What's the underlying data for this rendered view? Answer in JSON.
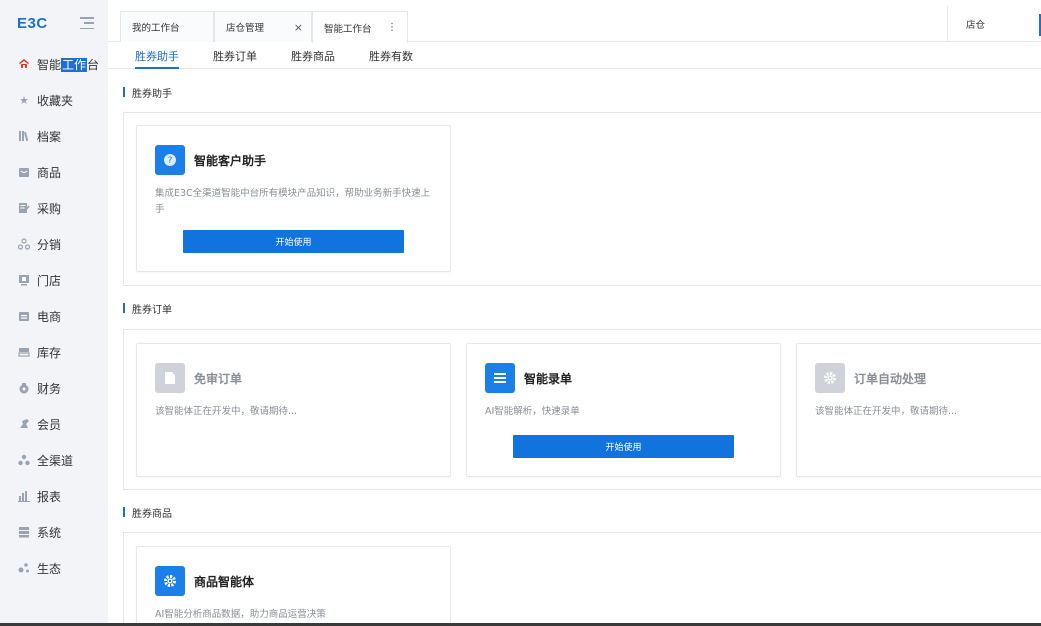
{
  "sidebar": {
    "logo": "E3C",
    "items": [
      {
        "label_pre": "智能",
        "label_hl": "工作",
        "label_post": "台",
        "icon": "workbench-icon"
      },
      {
        "label": "收藏夹",
        "icon": "star-icon"
      },
      {
        "label": "档案",
        "icon": "archive-icon"
      },
      {
        "label": "商品",
        "icon": "product-icon"
      },
      {
        "label": "采购",
        "icon": "purchase-icon"
      },
      {
        "label": "分销",
        "icon": "distribution-icon"
      },
      {
        "label": "门店",
        "icon": "store-icon"
      },
      {
        "label": "电商",
        "icon": "ecommerce-icon"
      },
      {
        "label": "库存",
        "icon": "inventory-icon"
      },
      {
        "label": "财务",
        "icon": "finance-icon"
      },
      {
        "label": "会员",
        "icon": "member-icon"
      },
      {
        "label": "全渠道",
        "icon": "omnichannel-icon"
      },
      {
        "label": "报表",
        "icon": "report-icon"
      },
      {
        "label": "系统",
        "icon": "system-icon"
      },
      {
        "label": "生态",
        "icon": "ecology-icon"
      }
    ]
  },
  "tabs": [
    {
      "label": "我的工作台"
    },
    {
      "label": "店仓管理",
      "close": "×"
    },
    {
      "label": "智能工作台",
      "more": "⋮"
    }
  ],
  "store": {
    "label": "店仓"
  },
  "subtabs": [
    "胜券助手",
    "胜券订单",
    "胜券商品",
    "胜券有数"
  ],
  "sections": [
    {
      "title": "胜券助手",
      "cards": [
        {
          "title": "智能客户助手",
          "desc": "集成E3C全渠道智能中台所有模块产品知识，帮助业务新手快速上手",
          "button": "开始使用",
          "icon": "question-icon",
          "enabled": true
        }
      ]
    },
    {
      "title": "胜券订单",
      "cards": [
        {
          "title": "免审订单",
          "desc": "该智能体正在开发中，敬请期待...",
          "icon": "document-icon",
          "enabled": false
        },
        {
          "title": "智能录单",
          "desc": "AI智能解析，快速录单",
          "button": "开始使用",
          "icon": "list-icon",
          "enabled": true
        },
        {
          "title": "订单自动处理",
          "desc": "该智能体正在开发中，敬请期待...",
          "icon": "gear-icon",
          "enabled": false
        }
      ]
    },
    {
      "title": "胜券商品",
      "cards": [
        {
          "title": "商品智能体",
          "desc": "AI智能分析商品数据，助力商品运营决策",
          "icon": "gear-icon",
          "enabled": true
        }
      ]
    }
  ],
  "colors": {
    "accent": "#1f6fd1",
    "button": "#1173dd",
    "icon_blue": "#1a7fe8",
    "icon_disabled": "#cfd3d9",
    "sidebar_bg": "#f2f4f8",
    "active_nav_icon": "#e03a2f"
  }
}
